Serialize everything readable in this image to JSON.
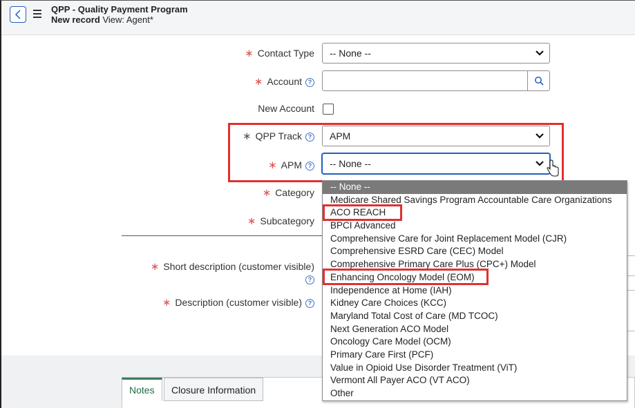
{
  "header": {
    "title": "QPP - Quality Payment Program",
    "subtitle_record": "New record",
    "subtitle_view": "View: Agent*"
  },
  "form": {
    "contact_type": {
      "label": "Contact Type",
      "value": "-- None --"
    },
    "account": {
      "label": "Account",
      "value": ""
    },
    "new_account": {
      "label": "New Account"
    },
    "qpp_track": {
      "label": "QPP Track",
      "value": "APM"
    },
    "apm": {
      "label": "APM",
      "value": "-- None --"
    },
    "category": {
      "label": "Category"
    },
    "subcategory": {
      "label": "Subcategory"
    },
    "short_description": {
      "label": "Short description (customer visible)"
    },
    "description": {
      "label": "Description (customer visible)"
    }
  },
  "apm_options": [
    "-- None --",
    "Medicare Shared Savings Program Accountable Care Organizations",
    "ACO REACH",
    "BPCI Advanced",
    "Comprehensive Care for Joint Replacement Model (CJR)",
    "Comprehensive ESRD Care (CEC) Model",
    "Comprehensive Primary Care Plus (CPC+) Model",
    "Enhancing Oncology Model (EOM)",
    "Independence at Home (IAH)",
    "Kidney Care Choices (KCC)",
    "Maryland Total Cost of Care (MD TCOC)",
    "Next Generation ACO Model",
    "Oncology Care Model (OCM)",
    "Primary Care First (PCF)",
    "Value in Opioid Use Disorder Treatment (ViT)",
    "Vermont All Payer ACO (VT ACO)",
    "Other"
  ],
  "tabs": [
    {
      "label": "Notes"
    },
    {
      "label": "Closure Information"
    }
  ],
  "icons": {
    "back": "chevron-left-icon",
    "menu": "hamburger-menu-icon",
    "search": "search-icon",
    "help": "help-circle-icon",
    "required": "asterisk-icon"
  },
  "colors": {
    "required": "#d9534f",
    "highlight": "#e0302f",
    "focus": "#1f5fbf",
    "selected_option": "#7a7a7a",
    "active_tab": "#3a7d5a"
  }
}
